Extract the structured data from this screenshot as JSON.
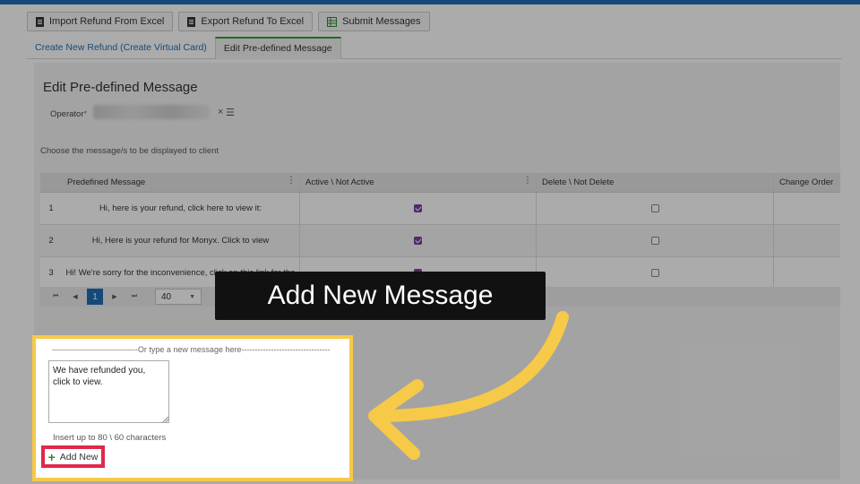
{
  "toolbar": {
    "buttons": [
      {
        "label": "Import Refund From Excel"
      },
      {
        "label": "Export Refund To Excel"
      },
      {
        "label": "Submit Messages"
      }
    ]
  },
  "tabs": [
    {
      "label": "Create New Refund (Create Virtual Card)"
    },
    {
      "label": "Edit Pre-defined Message"
    }
  ],
  "page": {
    "title": "Edit Pre-defined Message",
    "operator_label": "Operator",
    "required_mark": "*",
    "clear_icon": "×",
    "list_icon": "☰",
    "hint": "Choose the message/s to be displayed to client"
  },
  "grid": {
    "headers": [
      "Predefined Message",
      "Active \\ Not Active",
      "Delete \\ Not Delete",
      "Change Order"
    ],
    "menu_icon": "⋮",
    "rows": [
      {
        "num": "1",
        "message": "Hi, here is your refund, click here to view it:",
        "active": true,
        "delete": false
      },
      {
        "num": "2",
        "message": "Hi, Here is your refund for Monyx. Click to view",
        "active": true,
        "delete": false
      },
      {
        "num": "3",
        "message": "Hi! We're sorry for the inconvenience, click on this link for the",
        "active": true,
        "delete": false
      }
    ]
  },
  "pager": {
    "first": "⏮",
    "prev": "◀",
    "current": "1",
    "next": "▶",
    "last": "⏭",
    "page_size": "40",
    "dropdown_icon": "▼"
  },
  "new_message": {
    "separator": "--------------------------------Or type a new message here---------------------------------",
    "text": "We have refunded you, click to view.",
    "limit": "Insert up to 80 \\ 60 characters",
    "add_plus": "+",
    "add_label": "Add New"
  },
  "callout": {
    "text": "Add New Message"
  },
  "colors": {
    "highlight": "#f7c948",
    "add_button_border": "#e0284a",
    "accent": "#1f6fb5",
    "checkbox": "#7b3fa0"
  }
}
